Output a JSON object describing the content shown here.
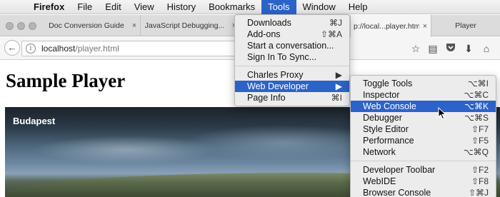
{
  "menubar": {
    "apple": "",
    "items": [
      "Firefox",
      "File",
      "Edit",
      "View",
      "History",
      "Bookmarks",
      "Tools",
      "Window",
      "Help"
    ],
    "active": "Tools"
  },
  "tabs": [
    {
      "label": "Doc Conversion Guide",
      "close": "×"
    },
    {
      "label": "JavaScript Debugging...",
      "close": "×"
    },
    {
      "label": "p://local...player.html",
      "close": "×"
    },
    {
      "label": "Player",
      "close": ""
    }
  ],
  "navbar": {
    "url_host": "localhost",
    "url_path": "/player.html",
    "info_icon": "i"
  },
  "page": {
    "title": "Sample Player",
    "video_caption": "Budapest"
  },
  "tools_menu": {
    "items": [
      {
        "label": "Downloads",
        "shortcut": "⌘J"
      },
      {
        "label": "Add-ons",
        "shortcut": "⇧⌘A"
      },
      {
        "label": "Start a conversation...",
        "shortcut": ""
      },
      {
        "label": "Sign In To Sync...",
        "shortcut": ""
      },
      {
        "label": "Charles Proxy",
        "shortcut": "▶"
      },
      {
        "label": "Web Developer",
        "shortcut": "▶"
      },
      {
        "label": "Page Info",
        "shortcut": "⌘I"
      }
    ],
    "highlighted": "Web Developer"
  },
  "web_developer_menu": {
    "items": [
      {
        "label": "Toggle Tools",
        "shortcut": "⌥⌘I"
      },
      {
        "label": "Inspector",
        "shortcut": "⌥⌘C"
      },
      {
        "label": "Web Console",
        "shortcut": "⌥⌘K"
      },
      {
        "label": "Debugger",
        "shortcut": "⌥⌘S"
      },
      {
        "label": "Style Editor",
        "shortcut": "⇧F7"
      },
      {
        "label": "Performance",
        "shortcut": "⇧F5"
      },
      {
        "label": "Network",
        "shortcut": "⌥⌘Q"
      },
      {
        "label": "Developer Toolbar",
        "shortcut": "⇧F2"
      },
      {
        "label": "WebIDE",
        "shortcut": "⇧F8"
      },
      {
        "label": "Browser Console",
        "shortcut": "⇧⌘J"
      }
    ],
    "highlighted": "Web Console"
  },
  "colors": {
    "menu_highlight": "#2c63c9",
    "menu_background": "#ececec"
  }
}
